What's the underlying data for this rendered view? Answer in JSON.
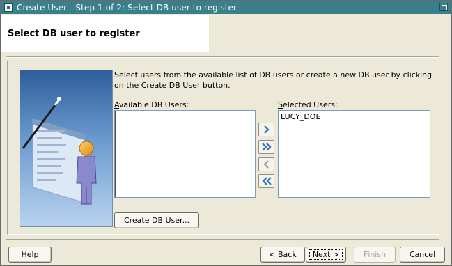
{
  "window": {
    "title": "Create User - Step 1 of 2: Select DB user to register"
  },
  "header": {
    "title": "Select DB user to register"
  },
  "main": {
    "instructions": "Select users from the available list of DB users or create a new DB user by clicking on the Create DB User button.",
    "available_label_mnemonic": "A",
    "available_label_rest": "vailable DB Users:",
    "available_items": [],
    "selected_label_mnemonic": "S",
    "selected_label_rest": "elected Users:",
    "selected_items": [
      "LUCY_DOE"
    ],
    "create_button_mnemonic": "C",
    "create_button_rest": "reate DB User..."
  },
  "shuttle_icons": [
    "move-right-icon",
    "move-all-right-icon",
    "move-left-icon",
    "move-all-left-icon"
  ],
  "footer": {
    "help_mnemonic": "H",
    "help_rest": "elp",
    "back_prefix": "< ",
    "back_mnemonic": "B",
    "back_rest": "ack",
    "next_mnemonic": "N",
    "next_rest": "ext >",
    "finish_mnemonic": "F",
    "finish_rest": "inish",
    "cancel_label": "Cancel"
  },
  "colors": {
    "titlebar": "#3a7f8c",
    "dialog_bg": "#ece9d8",
    "shuttle_arrow": "#2f6fb5"
  }
}
